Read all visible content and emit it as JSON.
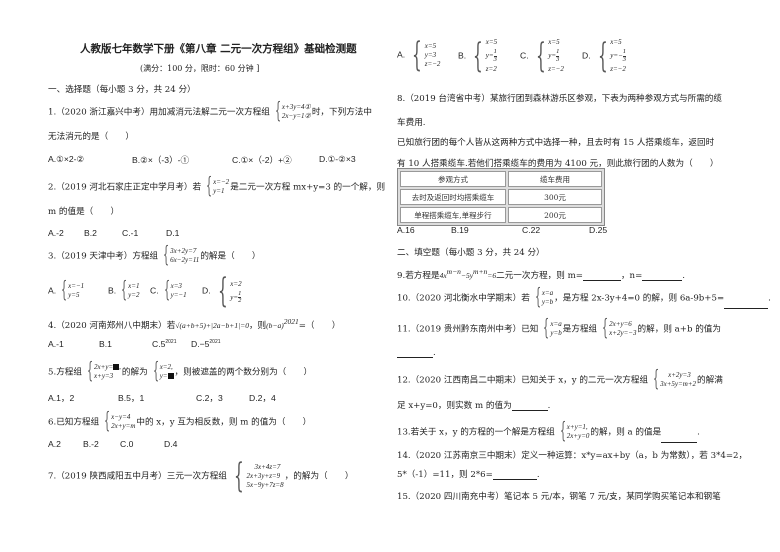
{
  "header": {
    "title": "人教版七年数学下册《第八章  二元一次方程组》基础检测题",
    "subtitle": "(满分：100 分，限时：60 分钟 ]"
  },
  "section1": {
    "heading": "一、选择题（每小题 3 分，共 24 分）"
  },
  "q1": {
    "stem_a": "1.（2020 浙江嘉兴中考）用加减消元法解二元一次方程组",
    "eq1": "x+3y=4①",
    "eq2": "2x−y=1②",
    "stem_b": "时，下列方法中",
    "stem_c": "无法消元的是（　　）",
    "options": [
      "A.①×2-②",
      "B.②×（-3）-①",
      "C.①×（-2）+②",
      "D.①-②×3"
    ]
  },
  "q2": {
    "stem_a": "2.（2019 河北石家庄正定中学月考）若",
    "eq1": "x=−2",
    "eq2": "y=1",
    "stem_b": "是二元一次方程 mx+y=3 的一个解，则",
    "stem_c": "m 的值是（　　）",
    "options": [
      "A.-2",
      "B.2",
      "C.-1",
      "D.1"
    ]
  },
  "q3": {
    "stem_a": "3.（2019 天津中考）方程组",
    "eq1": "3x+2y=7",
    "eq2": "6x−2y=11",
    "stem_b": "的解是（　　）",
    "options": [
      {
        "label": "A.",
        "l1": "x=−1",
        "l2": "y=5"
      },
      {
        "label": "B.",
        "l1": "x=1",
        "l2": "y=2"
      },
      {
        "label": "C.",
        "l1": "x=3",
        "l2": "y=−1"
      },
      {
        "label": "D.",
        "l1": "x=2",
        "l2": "y=",
        "num": "1",
        "den": "2"
      }
    ]
  },
  "q4": {
    "stem_a": "4.（2020 河南郑州八中期末）若",
    "expr": "√(a+b+5)+|2a−b+1|=0",
    "stem_b": "，则",
    "expr2": "(b−a)",
    "exp": "2021",
    "stem_c": "=（　　）",
    "options": [
      "A.-1",
      "B.1",
      "C.5",
      "D.−5"
    ],
    "option_exp": "2021"
  },
  "q5": {
    "stem_a": "5.方程组",
    "eq1": "2x+y=",
    "eq2": "x+y=3",
    "stem_b": "的解为",
    "sol1": "x=2,",
    "sol2": "y=",
    "stem_c": "，则被遮盖的两个数分别为（　　）",
    "options": [
      "A.1，2",
      "B.5，1",
      "C.2，3",
      "D.2，4"
    ]
  },
  "q6": {
    "stem_a": "6.已知方程组",
    "eq1": "x−y=4",
    "eq2": "2x+y=m",
    "stem_b": "中的 x，y 互为相反数，则 m 的值为（　　）",
    "options": [
      "A.2",
      "B.-2",
      "C.0",
      "D.4"
    ]
  },
  "q7": {
    "stem_a": "7.（2019 陕西咸阳五中月考）三元一次方程组",
    "eq1": "3x+4z=7",
    "eq2": "2x+3y+z=9",
    "eq3": "5x−9y+7z=8",
    "stem_b": "，的解为（　　）",
    "options": [
      {
        "label": "A.",
        "l1": "x=5",
        "l2": "y=3",
        "l3": "z=−2"
      },
      {
        "label": "B.",
        "l1": "x=5",
        "l2": "y=",
        "num": "1",
        "den": "3",
        "l3": "z=2"
      },
      {
        "label": "C.",
        "l1": "x=5",
        "l2": "y=",
        "num": "1",
        "den": "3",
        "l3": "z=−2"
      },
      {
        "label": "D.",
        "l1": "x=5",
        "l2": "y=−",
        "num": "1",
        "den": "3",
        "l3": "z=−2"
      }
    ]
  },
  "q8": {
    "line1": "8.（2019 台湾省中考）某旅行团到森林游乐区参观，下表为两种参观方式与所需的缆",
    "line2": "车费用.",
    "line3": "已知旅行团的每个人皆从这两种方式中选择一种，且去时有 15 人搭乘缆车，返回时",
    "line4": "有 10 人搭乘缆车.若他们搭乘缆车的费用为 4100 元，则此旅行团的人数为（　　）",
    "table": {
      "headers": [
        "参观方式",
        "缆车费用"
      ],
      "rows": [
        [
          "去时及返回时均搭乘缆车",
          "300元"
        ],
        [
          "单程搭乘缆车,单程步行",
          "200元"
        ]
      ]
    },
    "options": [
      "A.16",
      "B.19",
      "C.22",
      "D.25"
    ]
  },
  "section2": {
    "heading": "二、填空题（每小题 3 分，共 24 分）"
  },
  "q9": {
    "stem_a": "9.若方程是",
    "expr_a": "4x",
    "exp_a": "m−n",
    "expr_b": "−5y",
    "exp_b": "m+n",
    "expr_c": "=6",
    "stem_b": "二元一次方程，则 m=",
    "stem_c": "，n=",
    "stem_d": "."
  },
  "q10": {
    "stem_a": "10.（2020 河北衡水中学期末）若",
    "eq1": "x=a",
    "eq2": "y=b",
    "stem_b": "，是方程 2x-3y+4=0 的解，则 6a-9b+5=",
    "stem_c": "."
  },
  "q11": {
    "stem_a": "11.（2019  贵州黔东南州中考）已知",
    "eq1": "x=a",
    "eq2": "y=b",
    "stem_b": "是方程组",
    "eq3": "2x+y=6",
    "eq4": "x+2y=−3",
    "stem_c": "的解，则  a+b  的值为",
    "stem_d": "."
  },
  "q12": {
    "stem_a": "12.（2020 江西南昌二中期末）已知关于 x，y 的二元一次方程组",
    "eq1": "x+2y=3",
    "eq2": "3x+5y=m+2",
    "stem_b": "的解满",
    "stem_c": "足 x+y=0，则实数 m 的值为",
    "stem_d": "."
  },
  "q13": {
    "stem_a": "13.若关于 x，y 的方程的一个解是方程组",
    "eq1": "x+y=1,",
    "eq2": "2x+y=0",
    "stem_b": "的解，则 a 的值是",
    "stem_c": "."
  },
  "q14": {
    "line1": "14.（2020 江苏南京三中期末）定义一种运算：x*y=ax+by（a，b 为常数），若 3*4=2，",
    "line2a": "5*（-1）=11，则 2*6=",
    "line2b": "."
  },
  "q15": {
    "line1": "15.（2020 四川南充中考）笔记本 5 元/本，钢笔 7 元/支，某同学购买笔记本和钢笔"
  }
}
